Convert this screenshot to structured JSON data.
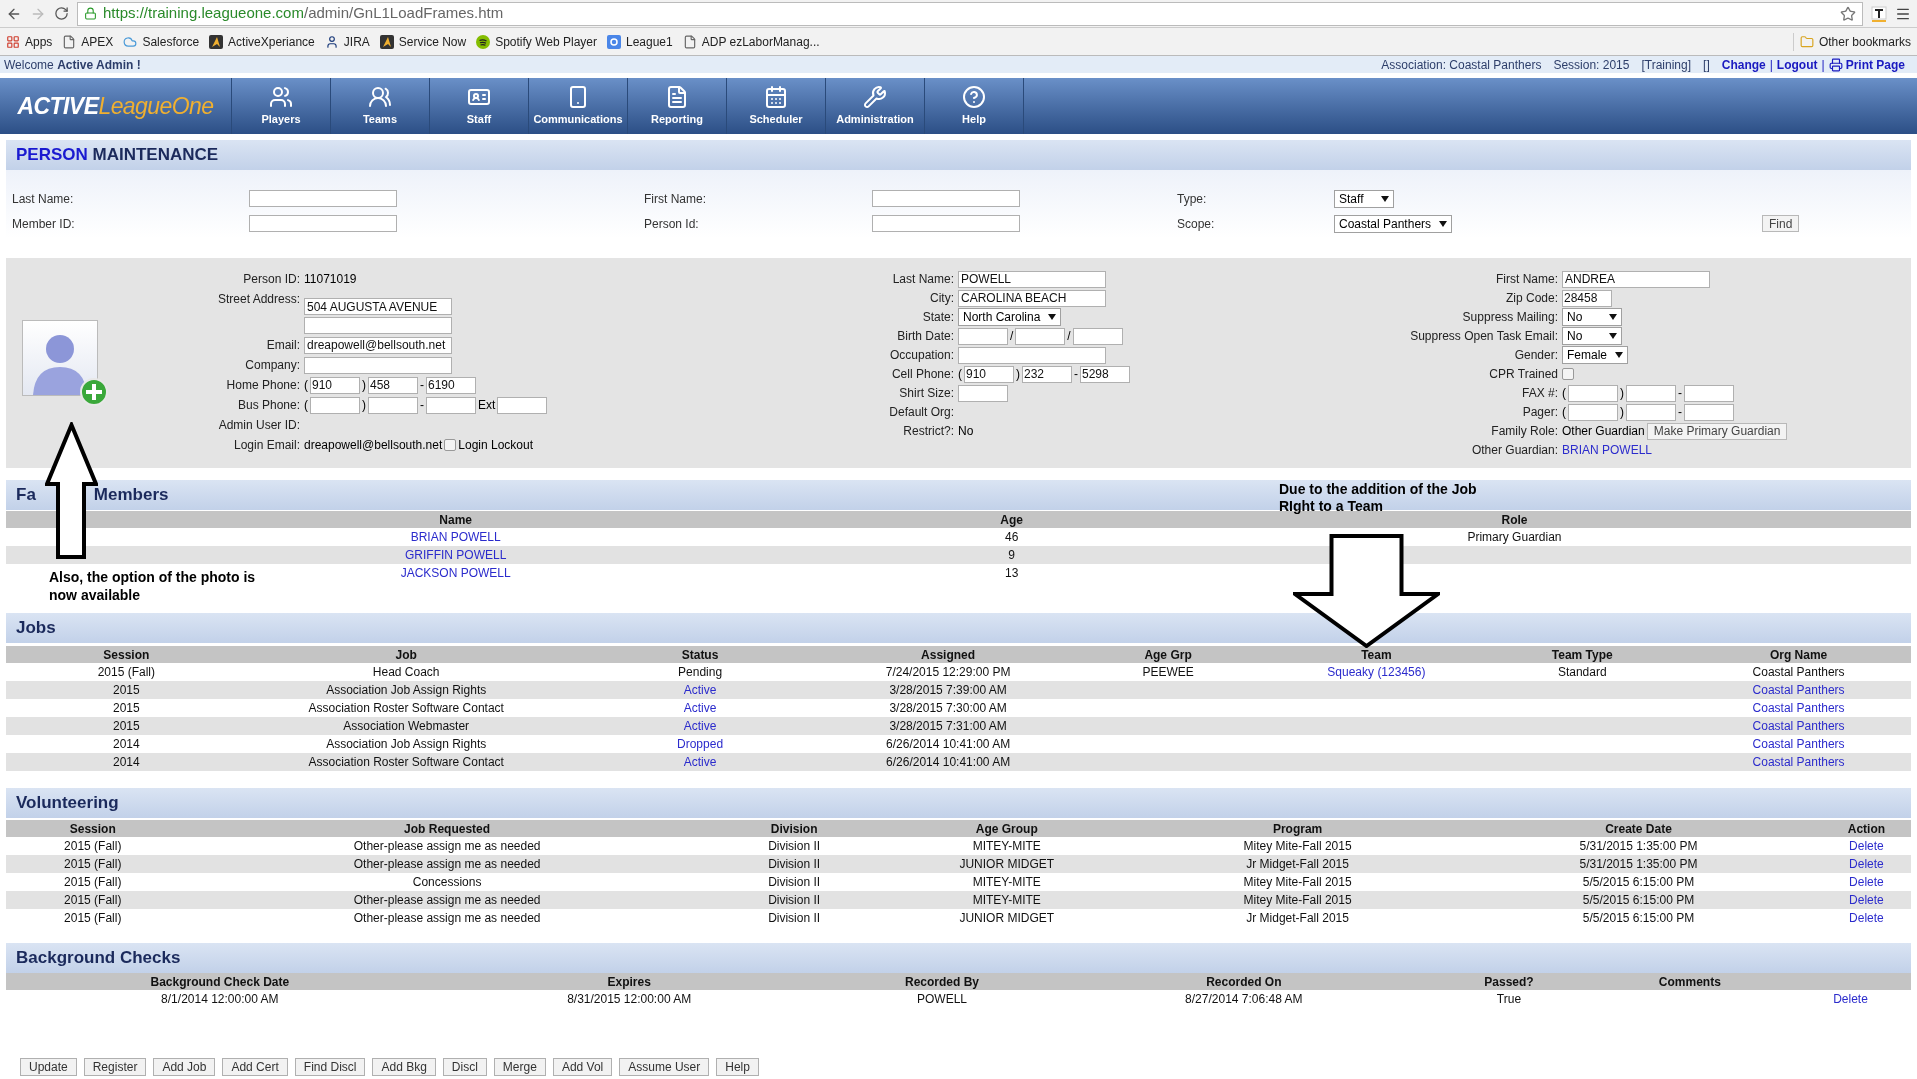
{
  "browser": {
    "url_host": "https://training.leagueone.com",
    "url_path": "/admin/GnL1LoadFrames.htm",
    "bookmarks": [
      {
        "label": "Apps",
        "kind": "grid"
      },
      {
        "label": "APEX",
        "kind": "page"
      },
      {
        "label": "Salesforce",
        "kind": "cloud"
      },
      {
        "label": "ActiveXperiance",
        "kind": "logo"
      },
      {
        "label": "JIRA",
        "kind": "figure"
      },
      {
        "label": "Service Now",
        "kind": "logo"
      },
      {
        "label": "Spotify Web Player",
        "kind": "circle"
      },
      {
        "label": "League1",
        "kind": "square"
      },
      {
        "label": "ADP ezLaborManag...",
        "kind": "page"
      }
    ],
    "other_bookmarks": "Other bookmarks"
  },
  "session_bar": {
    "welcome": "Welcome **Active Admin !**",
    "items": [
      {
        "kind": "text",
        "text": "Association: Coastal Panthers"
      },
      {
        "kind": "text",
        "text": "Session: 2015"
      },
      {
        "kind": "text",
        "text": "[Training]"
      },
      {
        "kind": "text",
        "text": "[]"
      },
      {
        "kind": "link",
        "text": "Change"
      },
      {
        "kind": "sep",
        "text": "|"
      },
      {
        "kind": "link",
        "text": "Logout"
      },
      {
        "kind": "sep",
        "text": "|"
      },
      {
        "kind": "print",
        "text": "Print Page"
      }
    ]
  },
  "logo": {
    "lead": "ACTIVE",
    "rest": "LeagueOne"
  },
  "nav": [
    "Players",
    "Teams",
    "Staff",
    "Communications",
    "Reporting",
    "Scheduler",
    "Administration",
    "Help"
  ],
  "page_title": {
    "lead": "PERSON",
    "rest": "MAINTENANCE"
  },
  "search": {
    "rows": [
      [
        {
          "kind": "label",
          "text": "Last Name:"
        },
        {
          "kind": "input"
        },
        {
          "kind": "label",
          "text": "First Name:"
        },
        {
          "kind": "input"
        },
        {
          "kind": "label",
          "text": "Type:"
        },
        {
          "kind": "select",
          "value": "Staff"
        }
      ],
      [
        {
          "kind": "label",
          "text": "Member ID:"
        },
        {
          "kind": "input"
        },
        {
          "kind": "label",
          "text": "Person Id:"
        },
        {
          "kind": "input"
        },
        {
          "kind": "label",
          "text": "Scope:"
        },
        {
          "kind": "select",
          "value": "Coastal Panthers"
        },
        {
          "kind": "button",
          "text": "Find"
        }
      ]
    ]
  },
  "details": {
    "columns": [
      [
        {
          "label": "Person ID:",
          "kind": "row",
          "pieces": [
            {
              "kind": "text",
              "text": "11071019"
            }
          ]
        },
        {
          "label": "Street Address:",
          "kind": "stack",
          "pieces": [
            {
              "kind": "input",
              "value": "504 AUGUSTA AVENUE"
            },
            {
              "kind": "input"
            }
          ]
        },
        {
          "label": "Email:",
          "kind": "row",
          "pieces": [
            {
              "kind": "input",
              "value": "dreapowell@bellsouth.net"
            }
          ]
        },
        {
          "label": "Company:",
          "kind": "row",
          "pieces": [
            {
              "kind": "input"
            }
          ]
        },
        {
          "label": "Home Phone:",
          "kind": "row",
          "pieces": [
            {
              "kind": "sep",
              "text": "("
            },
            {
              "kind": "short_input",
              "value": "910"
            },
            {
              "kind": "sep",
              "text": ")"
            },
            {
              "kind": "short_input",
              "value": "458"
            },
            {
              "kind": "sep",
              "text": "-"
            },
            {
              "kind": "short_input",
              "value": "6190"
            }
          ]
        },
        {
          "label": "Bus Phone:",
          "kind": "row",
          "pieces": [
            {
              "kind": "sep",
              "text": "("
            },
            {
              "kind": "short_input"
            },
            {
              "kind": "sep",
              "text": ")"
            },
            {
              "kind": "short_input"
            },
            {
              "kind": "sep",
              "text": "-"
            },
            {
              "kind": "short_input"
            },
            {
              "kind": "text",
              "text": "Ext"
            },
            {
              "kind": "short_input"
            }
          ]
        },
        {
          "label": "Admin User ID:",
          "kind": "row"
        },
        {
          "label": "Login Email:",
          "kind": "row",
          "pieces": [
            {
              "kind": "text",
              "text": "dreapowell@bellsouth.net"
            },
            {
              "kind": "checkbox",
              "checked": false
            },
            {
              "kind": "text",
              "text": "Login Lockout"
            }
          ]
        }
      ],
      [
        {
          "label": "Last Name:",
          "kind": "row",
          "pieces": [
            {
              "kind": "input",
              "value": "POWELL"
            }
          ]
        },
        {
          "label": "City:",
          "kind": "row",
          "pieces": [
            {
              "kind": "input",
              "value": "CAROLINA BEACH"
            }
          ]
        },
        {
          "label": "State:",
          "kind": "row",
          "pieces": [
            {
              "kind": "select",
              "value": "North Carolina"
            }
          ]
        },
        {
          "label": "Birth Date:",
          "kind": "row",
          "pieces": [
            {
              "kind": "short_input"
            },
            {
              "kind": "sep",
              "text": "/"
            },
            {
              "kind": "short_input"
            },
            {
              "kind": "sep",
              "text": "/"
            },
            {
              "kind": "short_input"
            }
          ]
        },
        {
          "label": "Occupation:",
          "kind": "row",
          "pieces": [
            {
              "kind": "input"
            }
          ]
        },
        {
          "label": "Cell Phone:",
          "kind": "row",
          "pieces": [
            {
              "kind": "sep",
              "text": "("
            },
            {
              "kind": "short_input",
              "value": "910"
            },
            {
              "kind": "sep",
              "text": ")"
            },
            {
              "kind": "short_input",
              "value": "232"
            },
            {
              "kind": "sep",
              "text": "-"
            },
            {
              "kind": "short_input",
              "value": "5298"
            }
          ]
        },
        {
          "label": "Shirt Size:",
          "kind": "row",
          "pieces": [
            {
              "kind": "short_input"
            }
          ]
        },
        {
          "label": "Default Org:",
          "kind": "row"
        },
        {
          "label": "Restrict?:",
          "kind": "row",
          "pieces": [
            {
              "kind": "text",
              "text": "No"
            }
          ]
        }
      ],
      [
        {
          "label": "First Name:",
          "kind": "row",
          "pieces": [
            {
              "kind": "input",
              "value": "ANDREA"
            }
          ]
        },
        {
          "label": "Zip Code:",
          "kind": "row",
          "pieces": [
            {
              "kind": "short_input",
              "value": "28458"
            }
          ]
        },
        {
          "label": "Suppress Mailing:",
          "kind": "row",
          "pieces": [
            {
              "kind": "select",
              "value": "No"
            }
          ]
        },
        {
          "label": "Suppress Open Task Email:",
          "kind": "row",
          "pieces": [
            {
              "kind": "select",
              "value": "No"
            }
          ]
        },
        {
          "label": "Gender:",
          "kind": "row",
          "pieces": [
            {
              "kind": "select",
              "value": "Female"
            }
          ]
        },
        {
          "label": "CPR Trained",
          "kind": "row",
          "pieces": [
            {
              "kind": "checkbox",
              "checked": false
            }
          ]
        },
        {
          "label": "FAX #:",
          "kind": "row",
          "pieces": [
            {
              "kind": "sep",
              "text": "("
            },
            {
              "kind": "short_input"
            },
            {
              "kind": "sep",
              "text": ")"
            },
            {
              "kind": "short_input"
            },
            {
              "kind": "sep",
              "text": "-"
            },
            {
              "kind": "short_input"
            }
          ]
        },
        {
          "label": "Pager:",
          "kind": "row",
          "pieces": [
            {
              "kind": "sep",
              "text": "("
            },
            {
              "kind": "short_input"
            },
            {
              "kind": "sep",
              "text": ")"
            },
            {
              "kind": "short_input"
            },
            {
              "kind": "sep",
              "text": "-"
            },
            {
              "kind": "short_input"
            }
          ]
        },
        {
          "label": "Family Role:",
          "kind": "row",
          "pieces": [
            {
              "kind": "text",
              "text": "Other Guardian"
            },
            {
              "kind": "button",
              "text": "Make Primary Guardian"
            }
          ]
        },
        {
          "label": "Other Guardian:",
          "kind": "row",
          "pieces": [
            {
              "kind": "link",
              "text": "BRIAN POWELL"
            }
          ]
        }
      ]
    ]
  },
  "family": {
    "title_start": "Fa",
    "title_end": "Members",
    "columns": [
      "Name",
      "Age",
      "Role"
    ],
    "rows": [
      {
        "name": {
          "link": "BRIAN POWELL"
        },
        "age": "46",
        "role": "Primary Guardian"
      },
      {
        "name": {
          "link": "GRIFFIN POWELL"
        },
        "age": "9"
      },
      {
        "name": {
          "link": "JACKSON POWELL"
        },
        "age": "13"
      }
    ]
  },
  "jobs": {
    "title": "Jobs",
    "columns": [
      "Session",
      "Job",
      "Status",
      "Assigned",
      "Age Grp",
      "Team",
      "Team Type",
      "Org Name"
    ],
    "rows": [
      {
        "session": "2015 (Fall)",
        "job": "Head Coach",
        "status": "Pending",
        "assigned": "7/24/2015 12:29:00 PM",
        "age_group": "PEEWEE",
        "team": {
          "link": "Squeaky (123456)"
        },
        "team_type": "Standard",
        "org_name": "Coastal Panthers"
      },
      {
        "session": "2015",
        "job": "Association Job Assign Rights",
        "status": {
          "link": "Active"
        },
        "assigned": "3/28/2015 7:39:00 AM",
        "org_name": {
          "link": "Coastal Panthers"
        }
      },
      {
        "session": "2015",
        "job": "Association Roster Software Contact",
        "status": {
          "link": "Active"
        },
        "assigned": "3/28/2015 7:30:00 AM",
        "org_name": {
          "link": "Coastal Panthers"
        }
      },
      {
        "session": "2015",
        "job": "Association Webmaster",
        "status": {
          "link": "Active"
        },
        "assigned": "3/28/2015 7:31:00 AM",
        "org_name": {
          "link": "Coastal Panthers"
        }
      },
      {
        "session": "2014",
        "job": "Association Job Assign Rights",
        "status": {
          "link": "Dropped"
        },
        "assigned": "6/26/2014 10:41:00 AM",
        "org_name": {
          "link": "Coastal Panthers"
        }
      },
      {
        "session": "2014",
        "job": "Association Roster Software Contact",
        "status": {
          "link": "Active"
        },
        "assigned": "6/26/2014 10:41:00 AM",
        "org_name": {
          "link": "Coastal Panthers"
        }
      }
    ]
  },
  "volunteering": {
    "title": "Volunteering",
    "columns": [
      "Session",
      "Job Requested",
      "Division",
      "Age Group",
      "Program",
      "Create Date",
      "Action"
    ],
    "rows": [
      {
        "session": "2015 (Fall)",
        "job_requested": "Other-please assign me as needed",
        "division": "Division II",
        "age_group": "MITEY-MITE",
        "program": "Mitey Mite-Fall 2015",
        "create_date": "5/31/2015 1:35:00 PM",
        "action": {
          "link": "Delete"
        }
      },
      {
        "session": "2015 (Fall)",
        "job_requested": "Other-please assign me as needed",
        "division": "Division II",
        "age_group": "JUNIOR MIDGET",
        "program": "Jr Midget-Fall 2015",
        "create_date": "5/31/2015 1:35:00 PM",
        "action": {
          "link": "Delete"
        }
      },
      {
        "session": "2015 (Fall)",
        "job_requested": "Concessions",
        "division": "Division II",
        "age_group": "MITEY-MITE",
        "program": "Mitey Mite-Fall 2015",
        "create_date": "5/5/2015 6:15:00 PM",
        "action": {
          "link": "Delete"
        }
      },
      {
        "session": "2015 (Fall)",
        "job_requested": "Other-please assign me as needed",
        "division": "Division II",
        "age_group": "MITEY-MITE",
        "program": "Mitey Mite-Fall 2015",
        "create_date": "5/5/2015 6:15:00 PM",
        "action": {
          "link": "Delete"
        }
      },
      {
        "session": "2015 (Fall)",
        "job_requested": "Other-please assign me as needed",
        "division": "Division II",
        "age_group": "JUNIOR MIDGET",
        "program": "Jr Midget-Fall 2015",
        "create_date": "5/5/2015 6:15:00 PM",
        "action": {
          "link": "Delete"
        }
      }
    ]
  },
  "background_checks": {
    "title": "Background Checks",
    "columns": [
      "Background Check Date",
      "Expires",
      "Recorded By",
      "Recorded On",
      "Passed?",
      "Comments"
    ],
    "rows": [
      {
        "date": "8/1/2014 12:00:00 AM",
        "expires": "8/31/2015 12:00:00 AM",
        "recorded_by": "POWELL",
        "recorded_on": "8/27/2014 7:06:48 AM",
        "passed": "True",
        "action": {
          "link": "Delete"
        }
      }
    ]
  },
  "buttons": [
    "Update",
    "Register",
    "Add Job",
    "Add Cert",
    "Find Discl",
    "Add Bkg",
    "Discl",
    "Merge",
    "Add Vol",
    "Assume User",
    "Help"
  ],
  "annotations": {
    "photo_note": "Also, the option of the photo is now available",
    "team_note": "Due to the addition of the Job RIght to a Team"
  }
}
